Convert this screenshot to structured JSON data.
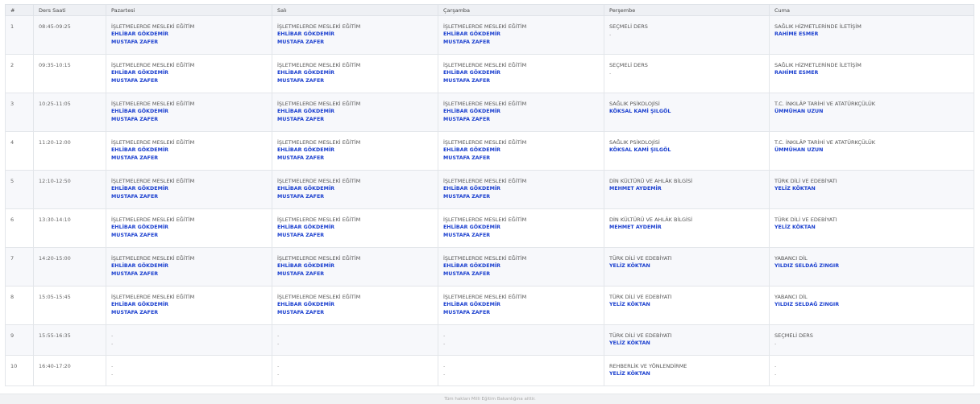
{
  "table": {
    "headers": [
      "#",
      "Ders Saati",
      "Pazartesi",
      "Salı",
      "Çarşamba",
      "Perşembe",
      "Cuma"
    ],
    "rows": [
      {
        "num": "1",
        "time": "08:45-09:25",
        "cells": [
          {
            "course": "İŞLETMELERDE MESLEKİ EĞİTİM",
            "teachers": [
              "EHLİBAR GÖKDEMİR",
              "MUSTAFA ZAFER"
            ]
          },
          {
            "course": "İŞLETMELERDE MESLEKİ EĞİTİM",
            "teachers": [
              "EHLİBAR GÖKDEMİR",
              "MUSTAFA ZAFER"
            ]
          },
          {
            "course": "İŞLETMELERDE MESLEKİ EĞİTİM",
            "teachers": [
              "EHLİBAR GÖKDEMİR",
              "MUSTAFA ZAFER"
            ]
          },
          {
            "course": "SEÇMELİ DERS",
            "teachers": [
              "-"
            ]
          },
          {
            "course": "SAĞLIK HİZMETLERİNDE İLETİŞİM",
            "teachers": [
              "RAHİME ESMER"
            ]
          }
        ]
      },
      {
        "num": "2",
        "time": "09:35-10:15",
        "cells": [
          {
            "course": "İŞLETMELERDE MESLEKİ EĞİTİM",
            "teachers": [
              "EHLİBAR GÖKDEMİR",
              "MUSTAFA ZAFER"
            ]
          },
          {
            "course": "İŞLETMELERDE MESLEKİ EĞİTİM",
            "teachers": [
              "EHLİBAR GÖKDEMİR",
              "MUSTAFA ZAFER"
            ]
          },
          {
            "course": "İŞLETMELERDE MESLEKİ EĞİTİM",
            "teachers": [
              "EHLİBAR GÖKDEMİR",
              "MUSTAFA ZAFER"
            ]
          },
          {
            "course": "SEÇMELİ DERS",
            "teachers": [
              "-"
            ]
          },
          {
            "course": "SAĞLIK HİZMETLERİNDE İLETİŞİM",
            "teachers": [
              "RAHİME ESMER"
            ]
          }
        ]
      },
      {
        "num": "3",
        "time": "10:25-11:05",
        "cells": [
          {
            "course": "İŞLETMELERDE MESLEKİ EĞİTİM",
            "teachers": [
              "EHLİBAR GÖKDEMİR",
              "MUSTAFA ZAFER"
            ]
          },
          {
            "course": "İŞLETMELERDE MESLEKİ EĞİTİM",
            "teachers": [
              "EHLİBAR GÖKDEMİR",
              "MUSTAFA ZAFER"
            ]
          },
          {
            "course": "İŞLETMELERDE MESLEKİ EĞİTİM",
            "teachers": [
              "EHLİBAR GÖKDEMİR",
              "MUSTAFA ZAFER"
            ]
          },
          {
            "course": "SAĞLIK PSİKOLOJİSİ",
            "teachers": [
              "KÖKSAL KAMİ ŞILGÖL"
            ]
          },
          {
            "course": "T.C. İNKILÂP TARİHİ VE ATATÜRKÇÜLÜK",
            "teachers": [
              "ÜMMÜHAN UZUN"
            ]
          }
        ]
      },
      {
        "num": "4",
        "time": "11:20-12:00",
        "cells": [
          {
            "course": "İŞLETMELERDE MESLEKİ EĞİTİM",
            "teachers": [
              "EHLİBAR GÖKDEMİR",
              "MUSTAFA ZAFER"
            ]
          },
          {
            "course": "İŞLETMELERDE MESLEKİ EĞİTİM",
            "teachers": [
              "EHLİBAR GÖKDEMİR",
              "MUSTAFA ZAFER"
            ]
          },
          {
            "course": "İŞLETMELERDE MESLEKİ EĞİTİM",
            "teachers": [
              "EHLİBAR GÖKDEMİR",
              "MUSTAFA ZAFER"
            ]
          },
          {
            "course": "SAĞLIK PSİKOLOJİSİ",
            "teachers": [
              "KÖKSAL KAMİ ŞILGÖL"
            ]
          },
          {
            "course": "T.C. İNKILÂP TARİHİ VE ATATÜRKÇÜLÜK",
            "teachers": [
              "ÜMMÜHAN UZUN"
            ]
          }
        ]
      },
      {
        "num": "5",
        "time": "12:10-12:50",
        "cells": [
          {
            "course": "İŞLETMELERDE MESLEKİ EĞİTİM",
            "teachers": [
              "EHLİBAR GÖKDEMİR",
              "MUSTAFA ZAFER"
            ]
          },
          {
            "course": "İŞLETMELERDE MESLEKİ EĞİTİM",
            "teachers": [
              "EHLİBAR GÖKDEMİR",
              "MUSTAFA ZAFER"
            ]
          },
          {
            "course": "İŞLETMELERDE MESLEKİ EĞİTİM",
            "teachers": [
              "EHLİBAR GÖKDEMİR",
              "MUSTAFA ZAFER"
            ]
          },
          {
            "course": "DİN KÜLTÜRÜ VE AHLÂK BİLGİSİ",
            "teachers": [
              "MEHMET AYDEMİR"
            ]
          },
          {
            "course": "TÜRK DİLİ VE EDEBİYATI",
            "teachers": [
              "YELİZ KÖKTAN"
            ]
          }
        ]
      },
      {
        "num": "6",
        "time": "13:30-14:10",
        "cells": [
          {
            "course": "İŞLETMELERDE MESLEKİ EĞİTİM",
            "teachers": [
              "EHLİBAR GÖKDEMİR",
              "MUSTAFA ZAFER"
            ]
          },
          {
            "course": "İŞLETMELERDE MESLEKİ EĞİTİM",
            "teachers": [
              "EHLİBAR GÖKDEMİR",
              "MUSTAFA ZAFER"
            ]
          },
          {
            "course": "İŞLETMELERDE MESLEKİ EĞİTİM",
            "teachers": [
              "EHLİBAR GÖKDEMİR",
              "MUSTAFA ZAFER"
            ]
          },
          {
            "course": "DİN KÜLTÜRÜ VE AHLÂK BİLGİSİ",
            "teachers": [
              "MEHMET AYDEMİR"
            ]
          },
          {
            "course": "TÜRK DİLİ VE EDEBİYATI",
            "teachers": [
              "YELİZ KÖKTAN"
            ]
          }
        ]
      },
      {
        "num": "7",
        "time": "14:20-15:00",
        "cells": [
          {
            "course": "İŞLETMELERDE MESLEKİ EĞİTİM",
            "teachers": [
              "EHLİBAR GÖKDEMİR",
              "MUSTAFA ZAFER"
            ]
          },
          {
            "course": "İŞLETMELERDE MESLEKİ EĞİTİM",
            "teachers": [
              "EHLİBAR GÖKDEMİR",
              "MUSTAFA ZAFER"
            ]
          },
          {
            "course": "İŞLETMELERDE MESLEKİ EĞİTİM",
            "teachers": [
              "EHLİBAR GÖKDEMİR",
              "MUSTAFA ZAFER"
            ]
          },
          {
            "course": "TÜRK DİLİ VE EDEBİYATI",
            "teachers": [
              "YELİZ KÖKTAN"
            ]
          },
          {
            "course": "YABANCI DİL",
            "teachers": [
              "YILDIZ SELDAĞ ZINGIR"
            ]
          }
        ]
      },
      {
        "num": "8",
        "time": "15:05-15:45",
        "cells": [
          {
            "course": "İŞLETMELERDE MESLEKİ EĞİTİM",
            "teachers": [
              "EHLİBAR GÖKDEMİR",
              "MUSTAFA ZAFER"
            ]
          },
          {
            "course": "İŞLETMELERDE MESLEKİ EĞİTİM",
            "teachers": [
              "EHLİBAR GÖKDEMİR",
              "MUSTAFA ZAFER"
            ]
          },
          {
            "course": "İŞLETMELERDE MESLEKİ EĞİTİM",
            "teachers": [
              "EHLİBAR GÖKDEMİR",
              "MUSTAFA ZAFER"
            ]
          },
          {
            "course": "TÜRK DİLİ VE EDEBİYATI",
            "teachers": [
              "YELİZ KÖKTAN"
            ]
          },
          {
            "course": "YABANCI DİL",
            "teachers": [
              "YILDIZ SELDAĞ ZINGIR"
            ]
          }
        ]
      },
      {
        "num": "9",
        "time": "15:55-16:35",
        "cells": [
          {
            "course": "-",
            "teachers": [
              "-"
            ]
          },
          {
            "course": "-",
            "teachers": [
              "-"
            ]
          },
          {
            "course": "-",
            "teachers": [
              "-"
            ]
          },
          {
            "course": "TÜRK DİLİ VE EDEBİYATI",
            "teachers": [
              "YELİZ KÖKTAN"
            ]
          },
          {
            "course": "SEÇMELİ DERS",
            "teachers": [
              "-"
            ]
          }
        ]
      },
      {
        "num": "10",
        "time": "16:40-17:20",
        "cells": [
          {
            "course": "-",
            "teachers": [
              "-"
            ]
          },
          {
            "course": "-",
            "teachers": [
              "-"
            ]
          },
          {
            "course": "-",
            "teachers": [
              "-"
            ]
          },
          {
            "course": "REHBERLİK VE YÖNLENDİRME",
            "teachers": [
              "YELİZ KÖKTAN"
            ]
          },
          {
            "course": "-",
            "teachers": [
              "-"
            ]
          }
        ]
      }
    ]
  },
  "footer": {
    "text": "Tüm hakları Milli Eğitim Bakanlığına aittir."
  },
  "colors": {
    "teacher": "#1a3fcf",
    "header_bg": "#eef0f4",
    "odd_row": "#f7f8fb"
  }
}
